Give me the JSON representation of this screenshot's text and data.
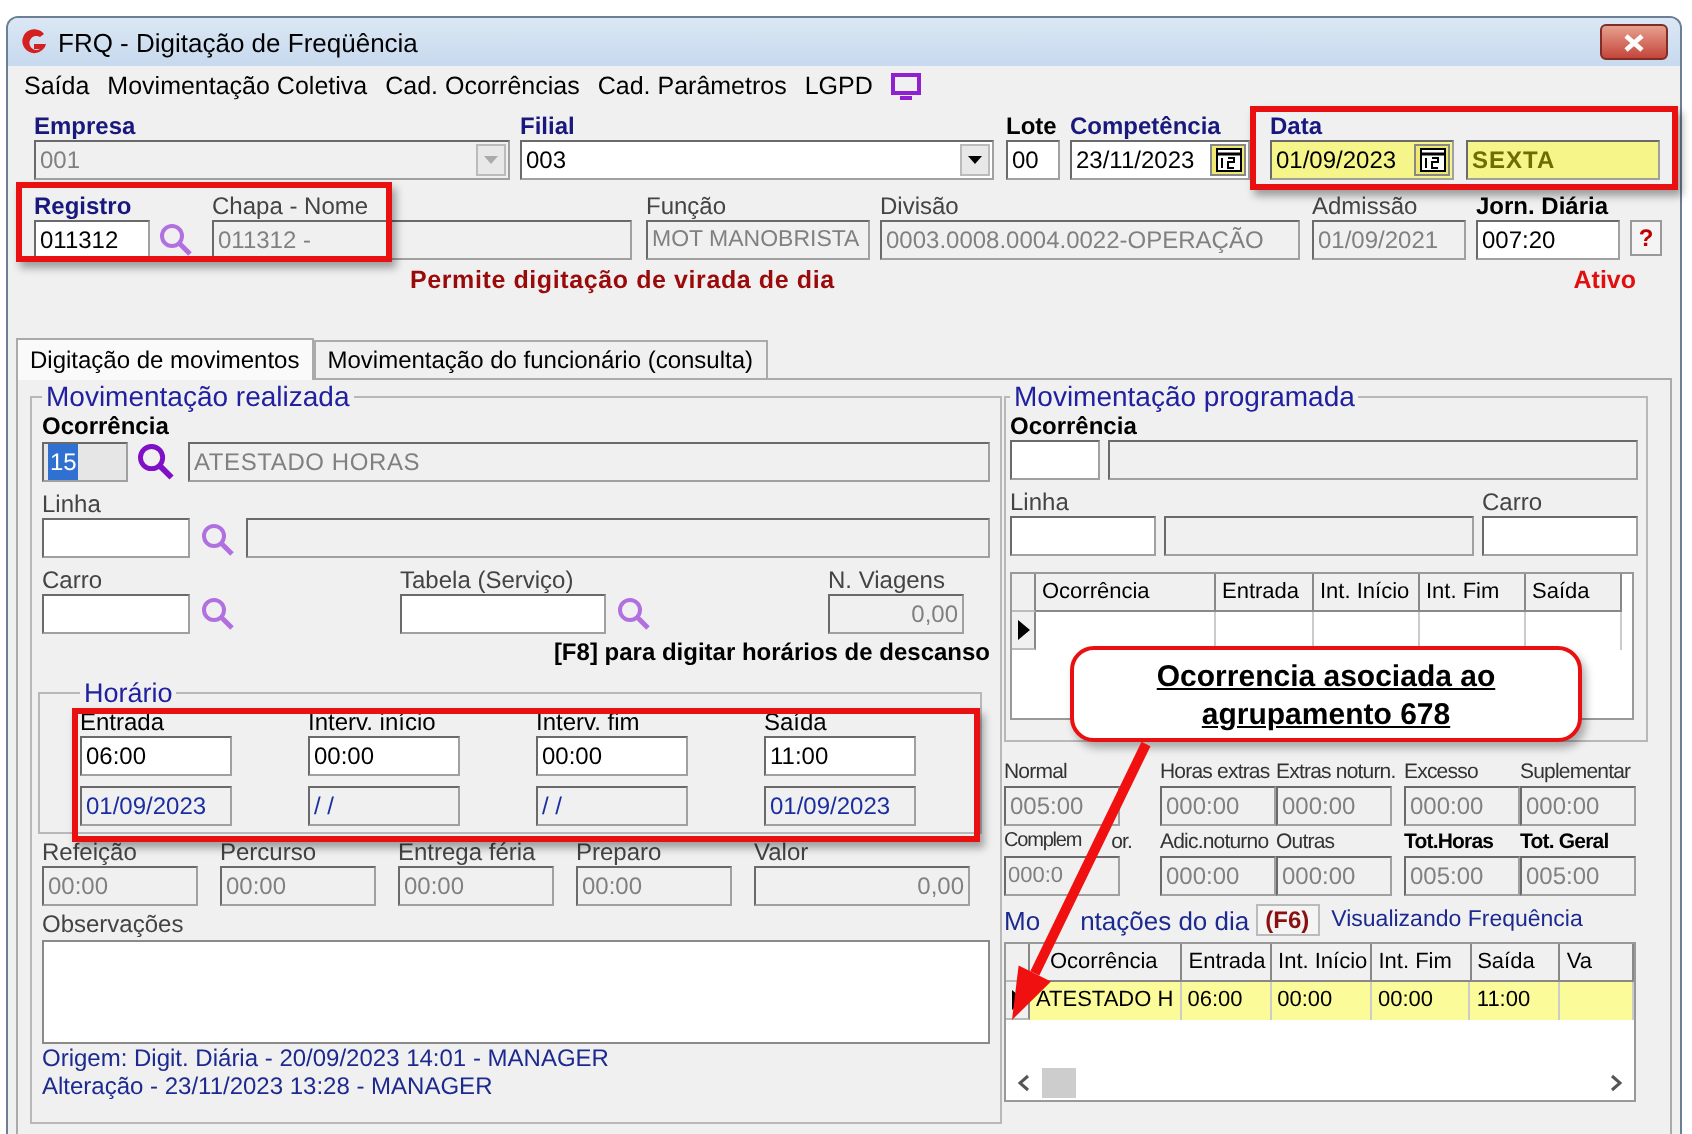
{
  "window": {
    "title": "FRQ - Digitação de Freqüência"
  },
  "menu": [
    {
      "label": "Saída"
    },
    {
      "label": "Movimentação Coletiva"
    },
    {
      "label": "Cad. Ocorrências"
    },
    {
      "label": "Cad. Parâmetros"
    },
    {
      "label": "LGPD"
    }
  ],
  "header": {
    "empresa": {
      "label": "Empresa",
      "value": "001"
    },
    "filial": {
      "label": "Filial",
      "value": "003"
    },
    "lote": {
      "label": "Lote",
      "value": "00"
    },
    "competencia": {
      "label": "Competência",
      "value": "23/11/2023"
    },
    "data": {
      "label": "Data",
      "value": "01/09/2023",
      "weekday": "SEXTA"
    },
    "registro": {
      "label": "Registro",
      "value": "011312"
    },
    "chapa_nome": {
      "label": "Chapa  -  Nome",
      "value": "011312 -"
    },
    "funcao": {
      "label": "Função",
      "value": "MOT MANOBRISTA"
    },
    "divisao": {
      "label": "Divisão",
      "value": "0003.0008.0004.0022-OPERAÇÃO"
    },
    "admissao": {
      "label": "Admissão",
      "value": "01/09/2021"
    },
    "jornada": {
      "label": "Jorn. Diária",
      "value": "007:20"
    },
    "help_button": "?",
    "notice": "Permite digitação de virada de dia",
    "status": "Ativo"
  },
  "tabs": [
    {
      "label": "Digitação de movimentos",
      "selected": true
    },
    {
      "label": "Movimentação do funcionário (consulta)",
      "selected": false
    }
  ],
  "realizada": {
    "title": "Movimentação realizada",
    "ocorrencia": {
      "label": "Ocorrência",
      "code": "15",
      "description": "ATESTADO HORAS"
    },
    "linha_label": "Linha",
    "carro_label": "Carro",
    "tabela_label": "Tabela (Serviço)",
    "viagens": {
      "label": "N. Viagens",
      "value": "0,00"
    },
    "f8_hint": "[F8] para digitar horários de descanso",
    "horario": {
      "title": "Horário",
      "slots": [
        {
          "label": "Entrada",
          "time": "06:00",
          "date": "01/09/2023"
        },
        {
          "label": "Interv. início",
          "time": "00:00",
          "date": "/ /"
        },
        {
          "label": "Interv. fim",
          "time": "00:00",
          "date": "/ /"
        },
        {
          "label": "Saída",
          "time": "11:00",
          "date": "01/09/2023"
        }
      ]
    },
    "extras": [
      {
        "label": "Refeição",
        "value": "00:00"
      },
      {
        "label": "Percurso",
        "value": "00:00"
      },
      {
        "label": "Entrega féria",
        "value": "00:00"
      },
      {
        "label": "Preparo",
        "value": "00:00"
      },
      {
        "label": "Valor",
        "value": "0,00"
      }
    ],
    "observacoes_label": "Observações",
    "origem": "Origem: Digit. Diária - 20/09/2023 14:01 - MANAGER",
    "alteracao": "Alteração - 23/11/2023 13:28 - MANAGER"
  },
  "programada": {
    "title": "Movimentação programada",
    "ocorrencia_label": "Ocorrência",
    "linha_label": "Linha",
    "carro_label": "Carro",
    "columns": [
      "Ocorrência",
      "Entrada",
      "Int. Início",
      "Int. Fim",
      "Saída"
    ]
  },
  "totals": [
    {
      "label": "Normal",
      "value": "005:00",
      "kind": "normal"
    },
    {
      "label": "Horas extras",
      "value": "000:00",
      "kind": "normal"
    },
    {
      "label": "Extras noturn.",
      "value": "000:00",
      "kind": "normal"
    },
    {
      "label": "Excesso",
      "value": "000:00",
      "kind": "normal"
    },
    {
      "label": "Suplementar",
      "value": "000:00",
      "kind": "normal"
    },
    {
      "label": "Complem",
      "label_end": "or.",
      "value": "000:0",
      "kind": "normal"
    },
    {
      "label": "Adic.noturno",
      "value": "000:00",
      "kind": "normal"
    },
    {
      "label": "Outras",
      "value": "000:00",
      "kind": "normal"
    },
    {
      "label": "Tot.Horas",
      "value": "005:00",
      "kind": "total"
    },
    {
      "label": "Tot. Geral",
      "value": "005:00",
      "kind": "total"
    }
  ],
  "day_movements": {
    "title": "Mo",
    "title_end": "ntações do dia",
    "shortcut": "(F6)",
    "viewing": "Visualizando Frequência",
    "columns": [
      "Ocorrência",
      "Entrada",
      "Int. Início",
      "Int. Fim",
      "Saída",
      "Va"
    ],
    "rows": [
      {
        "cells": [
          "ATESTADO H",
          "06:00",
          "00:00",
          "00:00",
          "11:00"
        ],
        "selected": true
      }
    ]
  },
  "callout": {
    "text": "Ocorrencia asociada ao agrupamento 678"
  }
}
